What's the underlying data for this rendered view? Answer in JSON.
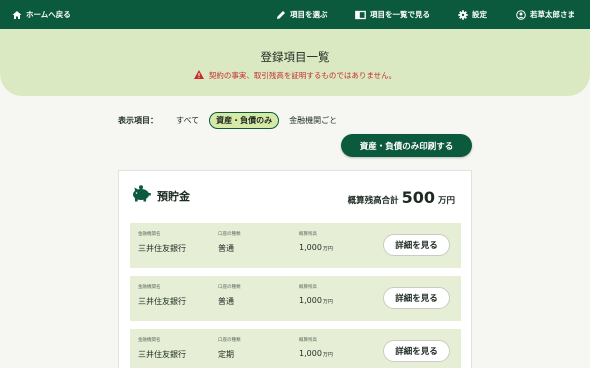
{
  "topnav": {
    "home": "ホームへ戻る",
    "select_items": "項目を選ぶ",
    "view_list": "項目を一覧で見る",
    "settings": "設定",
    "user": "若草太郎さま"
  },
  "hero": {
    "title": "登録項目一覧",
    "warning": "契約の事実、取引残高を証明するものではありません。"
  },
  "filter": {
    "label": "表示項目：",
    "options": [
      "すべて",
      "資産・負債のみ",
      "金融機関ごと"
    ],
    "selected": "資産・負債のみ"
  },
  "print_button": "資産・負債のみ印刷する",
  "card": {
    "title": "預貯金",
    "total_label": "概算残高合計",
    "total_value": "500",
    "total_unit": "万円",
    "column_labels": {
      "institution": "金融機関名",
      "account_type": "口座の種類",
      "balance": "概算残高"
    },
    "rows": [
      {
        "institution": "三井住友銀行",
        "account_type": "普通",
        "balance": "1,000",
        "unit": "万円",
        "button": "詳細を見る"
      },
      {
        "institution": "三井住友銀行",
        "account_type": "普通",
        "balance": "1,000",
        "unit": "万円",
        "button": "詳細を見る"
      },
      {
        "institution": "三井住友銀行",
        "account_type": "定期",
        "balance": "1,000",
        "unit": "万円",
        "button": "詳細を見る"
      }
    ]
  },
  "colors": {
    "brand_green": "#0c5a3e",
    "hero_bg": "#dbe9c3",
    "row_bg": "#e6efd6",
    "warning_red": "#c62d2d",
    "active_chip": "#d6e9a6"
  },
  "icons": [
    "home-icon",
    "pencil-icon",
    "book-icon",
    "gear-icon",
    "user-icon",
    "warning-icon",
    "piggy-bank-icon"
  ]
}
